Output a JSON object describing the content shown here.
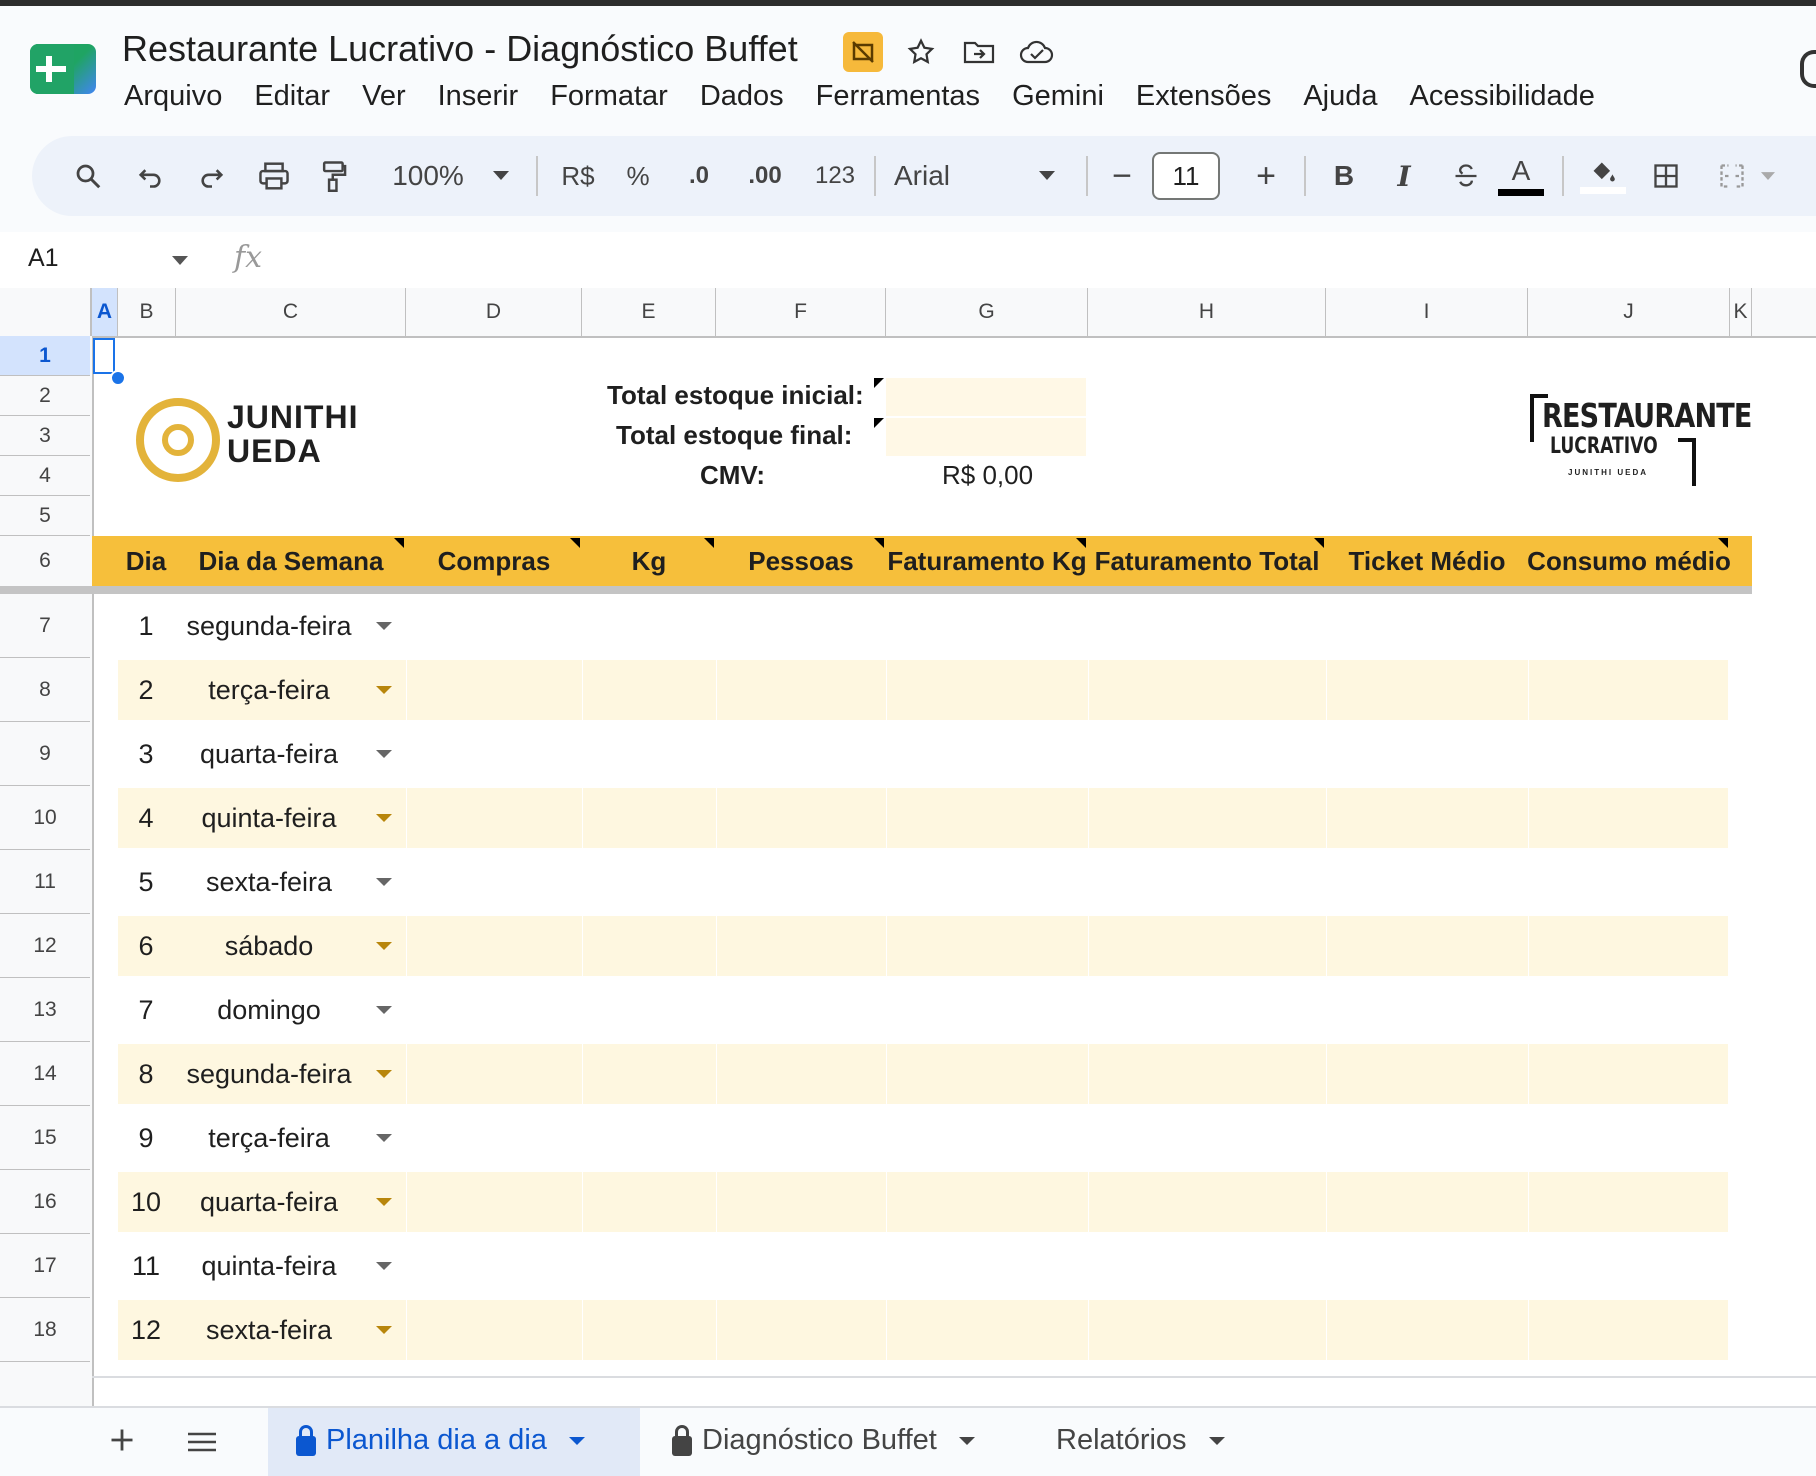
{
  "app": {
    "title": "Restaurante Lucrativo - Diagnóstico Buffet",
    "menu": [
      "Arquivo",
      "Editar",
      "Ver",
      "Inserir",
      "Formatar",
      "Dados",
      "Ferramentas",
      "Gemini",
      "Extensões",
      "Ajuda",
      "Acessibilidade"
    ]
  },
  "toolbar": {
    "zoom": "100%",
    "currency": "R$",
    "percent": "%",
    "dec_decrease": ".0",
    "dec_increase": ".00",
    "format_123": "123",
    "font": "Arial",
    "font_size": "11",
    "minus": "−",
    "plus": "+",
    "bold": "B",
    "italic": "I",
    "text_color": "A"
  },
  "formula_bar": {
    "cell_ref": "A1",
    "fx": "fx"
  },
  "columns": [
    "A",
    "B",
    "C",
    "D",
    "E",
    "F",
    "G",
    "H",
    "I",
    "J",
    "K"
  ],
  "rows": [
    "1",
    "2",
    "3",
    "4",
    "5",
    "6",
    "7",
    "8",
    "9",
    "10",
    "11",
    "12",
    "13",
    "14",
    "15",
    "16",
    "17",
    "18"
  ],
  "sheet": {
    "logo_name_line1": "JUNITHI",
    "logo_name_line2": "UEDA",
    "total_inicial_label": "Total estoque inicial:",
    "total_final_label": "Total estoque final:",
    "cmv_label": "CMV:",
    "cmv_value": "R$ 0,00",
    "brand_line1": "RESTAURANTE",
    "brand_line2": "LUCRATIVO",
    "brand_line3": "JUNITHI UEDA",
    "headers": [
      "Dia",
      "Dia da Semana",
      "Compras",
      "Kg",
      "Pessoas",
      "Faturamento Kg",
      "Faturamento Total",
      "Ticket Médio",
      "Consumo médio"
    ],
    "data_rows": [
      {
        "dia": "1",
        "semana": "segunda-feira"
      },
      {
        "dia": "2",
        "semana": "terça-feira"
      },
      {
        "dia": "3",
        "semana": "quarta-feira"
      },
      {
        "dia": "4",
        "semana": "quinta-feira"
      },
      {
        "dia": "5",
        "semana": "sexta-feira"
      },
      {
        "dia": "6",
        "semana": "sábado"
      },
      {
        "dia": "7",
        "semana": "domingo"
      },
      {
        "dia": "8",
        "semana": "segunda-feira"
      },
      {
        "dia": "9",
        "semana": "terça-feira"
      },
      {
        "dia": "10",
        "semana": "quarta-feira"
      },
      {
        "dia": "11",
        "semana": "quinta-feira"
      },
      {
        "dia": "12",
        "semana": "sexta-feira"
      }
    ]
  },
  "tabs": [
    {
      "label": "Planilha dia a dia",
      "active": true,
      "locked": true
    },
    {
      "label": "Diagnóstico Buffet",
      "active": false,
      "locked": true
    },
    {
      "label": "Relatórios",
      "active": false,
      "locked": false
    }
  ],
  "colors": {
    "header_band": "#f6bf3b",
    "alt_row": "#fef7e0",
    "accent": "#0b57d0"
  }
}
